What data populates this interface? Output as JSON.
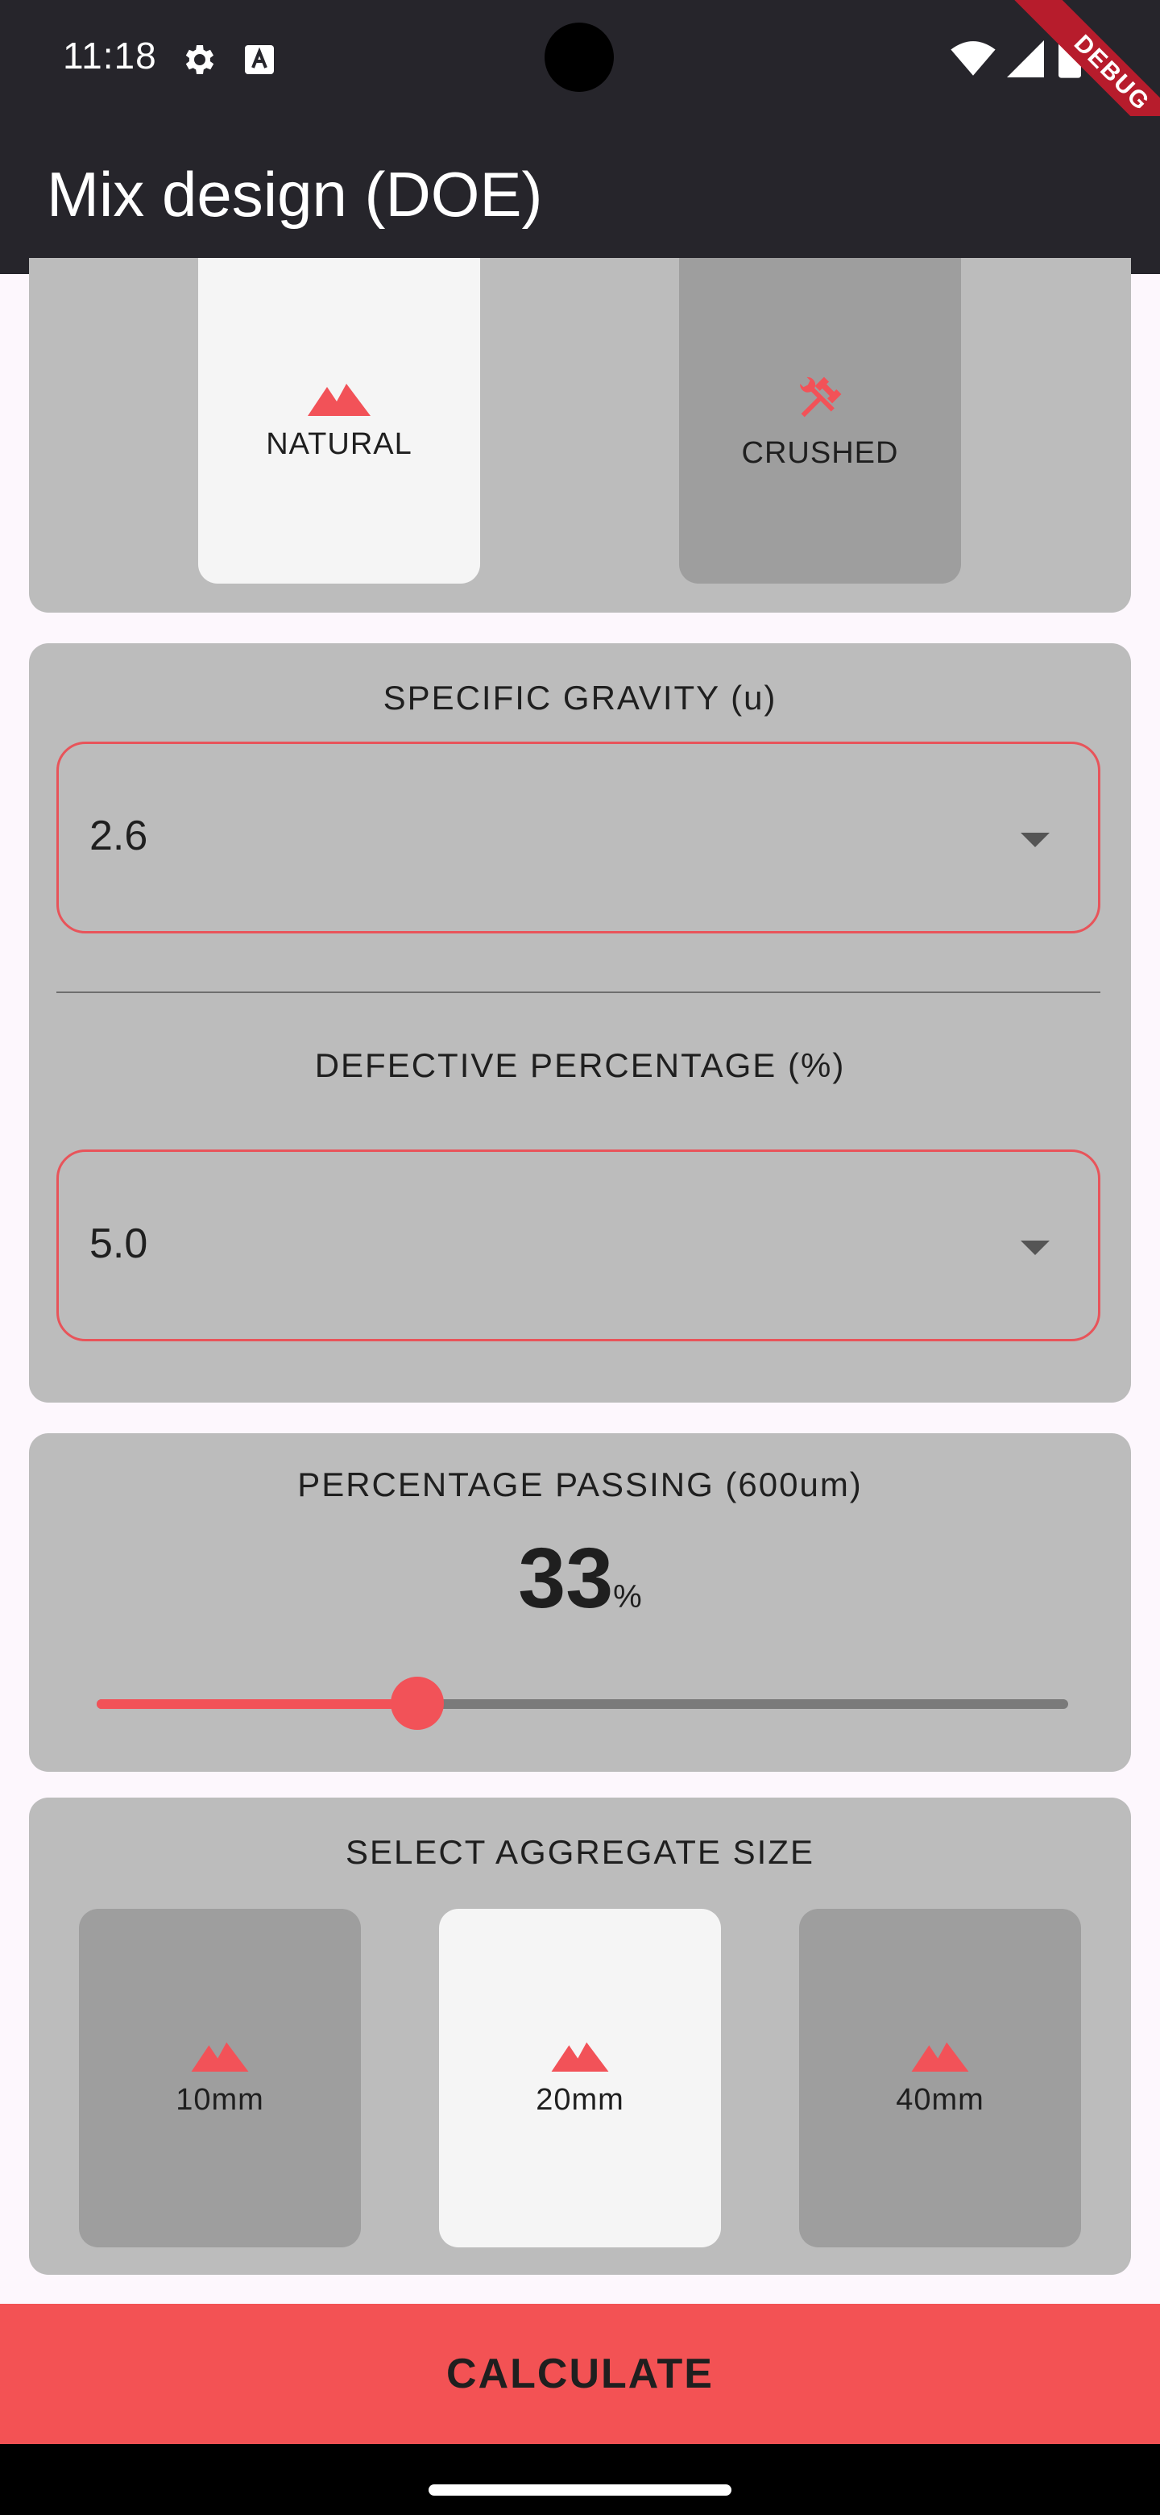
{
  "status_bar": {
    "time": "11:18",
    "icons": [
      "gear-icon",
      "font-a-icon",
      "wifi-icon",
      "signal-icon",
      "battery-icon"
    ],
    "debug_banner": "DEBUG"
  },
  "app_bar": {
    "title": "Mix design (DOE)"
  },
  "aggregate_type": {
    "options": [
      {
        "label": "NATURAL",
        "icon": "mountain-icon",
        "selected": true
      },
      {
        "label": "CRUSHED",
        "icon": "tools-icon",
        "selected": false
      }
    ]
  },
  "specific_gravity": {
    "title": "SPECIFIC GRAVITY (u)",
    "value": "2.6"
  },
  "defective_percentage": {
    "title": "DEFECTIVE PERCENTAGE (%)",
    "value": "5.0"
  },
  "percentage_passing": {
    "title": "PERCENTAGE PASSING (600um)",
    "value": "33",
    "unit": "%",
    "slider_fraction": 0.33
  },
  "aggregate_size": {
    "title": "SELECT AGGREGATE SIZE",
    "options": [
      {
        "label": "10mm",
        "icon": "mountain-icon",
        "selected": false
      },
      {
        "label": "20mm",
        "icon": "mountain-icon",
        "selected": true
      },
      {
        "label": "40mm",
        "icon": "mountain-icon",
        "selected": false
      }
    ]
  },
  "calculate_button": {
    "label": "CALCULATE"
  },
  "colors": {
    "accent": "#f25258",
    "app_bar": "#26252b",
    "card": "#bcbcbc",
    "tile": "#9e9e9e",
    "tile_selected": "#f5f5f5",
    "background": "#fdf7fd"
  }
}
